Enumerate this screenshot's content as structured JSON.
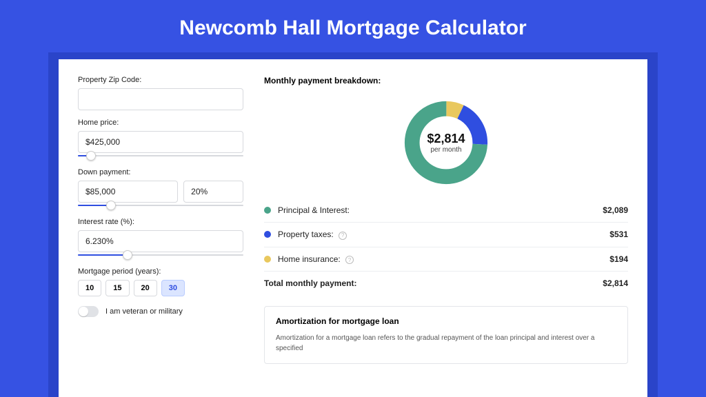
{
  "title": "Newcomb Hall Mortgage Calculator",
  "form": {
    "zip_label": "Property Zip Code:",
    "zip_value": "",
    "price_label": "Home price:",
    "price_value": "$425,000",
    "price_slider_pct": 8,
    "down_label": "Down payment:",
    "down_value": "$85,000",
    "down_pct_value": "20%",
    "down_slider_pct": 20,
    "rate_label": "Interest rate (%):",
    "rate_value": "6.230%",
    "rate_slider_pct": 30,
    "period_label": "Mortgage period (years):",
    "periods": [
      "10",
      "15",
      "20",
      "30"
    ],
    "period_active": "30",
    "veteran_label": "I am veteran or military"
  },
  "breakdown": {
    "title": "Monthly payment breakdown:",
    "center_amount": "$2,814",
    "center_sub": "per month",
    "items": [
      {
        "label": "Principal & Interest:",
        "value": "$2,089",
        "color": "#4aa48a",
        "info": false
      },
      {
        "label": "Property taxes:",
        "value": "$531",
        "color": "#2f4ee0",
        "info": true
      },
      {
        "label": "Home insurance:",
        "value": "$194",
        "color": "#e9c85e",
        "info": true
      }
    ],
    "total_label": "Total monthly payment:",
    "total_value": "$2,814"
  },
  "chart_data": {
    "type": "pie",
    "title": "Monthly payment breakdown",
    "series": [
      {
        "name": "Principal & Interest",
        "value": 2089,
        "color": "#4aa48a"
      },
      {
        "name": "Property taxes",
        "value": 531,
        "color": "#2f4ee0"
      },
      {
        "name": "Home insurance",
        "value": 194,
        "color": "#e9c85e"
      }
    ],
    "total": 2814
  },
  "amort": {
    "title": "Amortization for mortgage loan",
    "text": "Amortization for a mortgage loan refers to the gradual repayment of the loan principal and interest over a specified"
  }
}
